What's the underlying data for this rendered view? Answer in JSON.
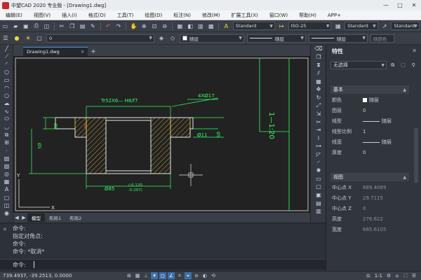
{
  "window": {
    "title": "中望CAD 2020 专业版 - [Drawing1.dwg]",
    "minimize": "—",
    "maximize": "□",
    "close": "✕"
  },
  "menu": [
    "编辑(E)",
    "视图(V)",
    "插入(I)",
    "格式(O)",
    "工具(T)",
    "绘图(D)",
    "标注(N)",
    "修改(M)",
    "扩展工具(X)",
    "窗口(W)",
    "帮助(H)",
    "APP+"
  ],
  "toolbar": {
    "text_style": "Standard",
    "dim_style": "ISO-25",
    "table_style": "Standard",
    "multileader_style": "Standard",
    "layer": "0",
    "color": "随层",
    "linetype": "随层",
    "lineweight": "随层",
    "plot_style": "随颜色"
  },
  "document": {
    "tab_label": "Drawing1.dwg",
    "tab_close": "✕",
    "tab_add": "+"
  },
  "drawing": {
    "thread_callout": "Tr52X6— H8/f7",
    "holes_callout": "4XØ17",
    "dim_left_short": "Ø8",
    "dim_left_long": "Ø5",
    "dim_right_small": "Ø11",
    "dim_right_stack": "Ø5",
    "dim_bottom": "Ø85",
    "tolerance_upper": "(-0.120",
    "tolerance_lower": "-0.207)",
    "frame_text": "1—1:20",
    "ucs_y": "Y",
    "ucs_x": "X"
  },
  "layout_tabs": {
    "model": "模型",
    "layout1": "布局1",
    "layout2": "布局2"
  },
  "command": {
    "lines": [
      "命令:",
      "指定对角点:",
      "命令:",
      "命令: *取消*"
    ],
    "prompt": "命令:"
  },
  "properties": {
    "title": "特性",
    "close": "✕",
    "selection": "无选择",
    "sections": {
      "basic": "基本",
      "view": "视图"
    },
    "basic_rows": [
      {
        "label": "颜色",
        "value": "随层"
      },
      {
        "label": "图层",
        "value": "0"
      },
      {
        "label": "线型",
        "value": "随层"
      },
      {
        "label": "线型比例",
        "value": "1"
      },
      {
        "label": "线宽",
        "value": "随层"
      },
      {
        "label": "厚度",
        "value": "0"
      }
    ],
    "view_rows": [
      {
        "label": "中心点 X",
        "value": "689.4089"
      },
      {
        "label": "中心点 Y",
        "value": "29.7115"
      },
      {
        "label": "中心点 Z",
        "value": "0"
      },
      {
        "label": "高度",
        "value": "276.622"
      },
      {
        "label": "宽度",
        "value": "665.6105"
      }
    ]
  },
  "status": {
    "coords": "739.4937, -39.2513, 0.0000",
    "scale": "1:1"
  },
  "colors": {
    "cad_green": "#33ff66",
    "cad_yellow": "#e8d84a",
    "cad_white": "#e8e8e8",
    "hatch": "#c8a040",
    "accent_blue": "#3d6fa8"
  }
}
